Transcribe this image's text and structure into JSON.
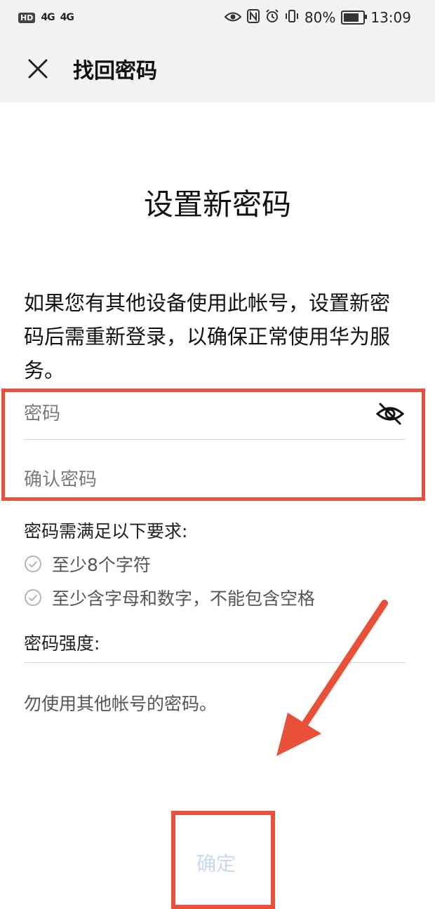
{
  "status_bar": {
    "hd_badge": "HD",
    "sig1": "4G",
    "sig2": "4G",
    "battery_pct": "80%",
    "time": "13:09",
    "battery_level": 0.8,
    "icons": [
      "eye-icon",
      "nfc-icon",
      "alarm-icon",
      "vibrate-icon",
      "battery-icon"
    ]
  },
  "header": {
    "title": "找回密码",
    "close_icon": "close-icon"
  },
  "page": {
    "heading": "设置新密码",
    "description": "如果您有其他设备使用此帐号，设置新密码后需重新登录，以确保正常使用华为服务。"
  },
  "form": {
    "password_placeholder": "密码",
    "password_value": "",
    "confirm_placeholder": "确认密码",
    "confirm_value": "",
    "visibility_icon": "eye-slash-icon"
  },
  "requirements": {
    "title": "密码需满足以下要求:",
    "items": [
      {
        "text": "至少8个字符",
        "icon": "check-circle-icon"
      },
      {
        "text": "至少含字母和数字，不能包含空格",
        "icon": "check-circle-icon"
      }
    ],
    "strength_label": "密码强度:",
    "warning": "勿使用其他帐号的密码。"
  },
  "actions": {
    "confirm_label": "确定"
  },
  "colors": {
    "annotation_red": "#e8503a",
    "confirm_disabled": "#c7d9ef"
  }
}
